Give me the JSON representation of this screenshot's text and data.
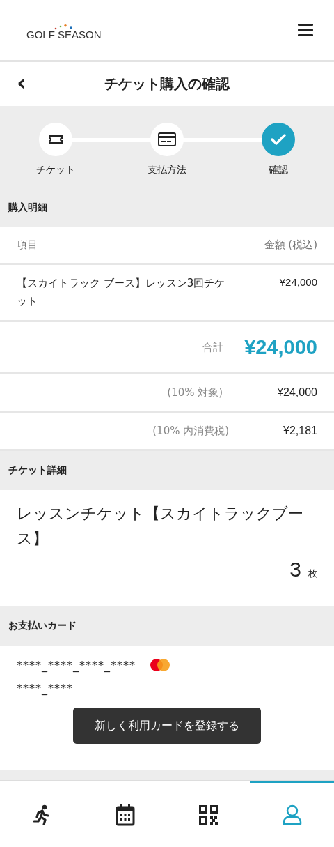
{
  "header": {
    "logo": "GOLF SEASON"
  },
  "title_bar": {
    "back": "‹",
    "title": "チケット購入の確認"
  },
  "steps": [
    {
      "kind": "ticket",
      "label": "チケット",
      "selected": false
    },
    {
      "kind": "card",
      "label": "支払方法",
      "selected": false
    },
    {
      "kind": "check",
      "label": "確認",
      "selected": true
    }
  ],
  "purchase": {
    "heading": "購入明細",
    "columns": [
      "項目",
      "金額 (税込)"
    ],
    "items": [
      {
        "name": "【スカイトラック ブース】レッスン3回チケット",
        "price": "¥24,000"
      }
    ],
    "total": {
      "label": "合計",
      "value": "¥24,000"
    },
    "tax_rows": [
      {
        "label": "(10% 対象)",
        "value": "¥24,000"
      },
      {
        "label": "(10% 内消費税)",
        "value": "¥2,181"
      }
    ]
  },
  "ticket_detail": {
    "heading": "チケット詳細",
    "name": "レッスンチケット【スカイトラックブース】",
    "count": "3",
    "unit": "枚"
  },
  "payment_card": {
    "heading": "お支払いカード",
    "number": "****_****_****_****",
    "expiry": "****_****",
    "register_button": "新しく利用カードを登録する"
  },
  "bottom_nav": [
    {
      "kind": "run",
      "selected": false
    },
    {
      "kind": "calendar",
      "selected": false
    },
    {
      "kind": "qr",
      "selected": false
    },
    {
      "kind": "user",
      "selected": true
    }
  ]
}
